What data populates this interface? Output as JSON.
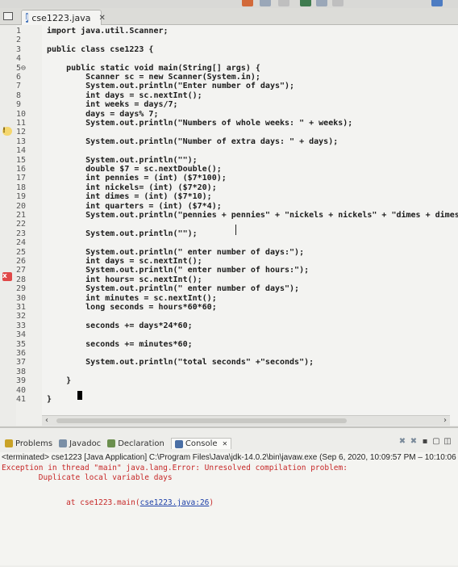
{
  "editor_tab": {
    "title": "cse1223.java",
    "close": "✕",
    "icon_text": "J"
  },
  "gutter": {
    "line_numbers": [
      "1",
      "2",
      "3",
      "4",
      "5⊖",
      "6",
      "7",
      "8",
      "9",
      "10",
      "11",
      "12",
      "13",
      "14",
      "15",
      "16",
      "17",
      "18",
      "19",
      "20",
      "21",
      "22",
      "23",
      "24",
      "25",
      "26",
      "27",
      "28",
      "29",
      "30",
      "31",
      "32",
      "33",
      "34",
      "35",
      "36",
      "37",
      "38",
      "39",
      "40",
      "41"
    ]
  },
  "code": {
    "lines": [
      "import java.util.Scanner;",
      "",
      "public class cse1223 {",
      "",
      "    public static void main(String[] args) {",
      "        Scanner sc = new Scanner(System.in);",
      "        System.out.println(\"Enter number of days\");",
      "        int days = sc.nextInt();",
      "        int weeks = days/7;",
      "        days = days% 7;",
      "        System.out.println(\"Numbers of whole weeks: \" + weeks);",
      "",
      "        System.out.println(\"Number of extra days: \" + days);",
      "",
      "        System.out.println(\"\");",
      "        double $7 = sc.nextDouble();",
      "        int pennies = (int) ($7*100);",
      "        int nickels= (int) ($7*20);",
      "        int dimes = (int) ($7*10);",
      "        int quarters = (int) ($7*4);",
      "        System.out.println(\"pennies + pennies\" + \"nickels + nickels\" + \"dimes + dimes\" +",
      "",
      "        System.out.println(\"\");",
      "",
      "        System.out.println(\" enter number of days:\");",
      "        int days = sc.nextInt();",
      "        System.out.println(\" enter number of hours:\");",
      "        int hours= sc.nextInt();",
      "        System.out.println(\" enter number of days\");",
      "        int minutes = sc.nextInt();",
      "        long seconds = hours*60*60;",
      "",
      "        seconds += days*24*60;",
      "",
      "        seconds += minutes*60;",
      "",
      "        System.out.println(\"total seconds\" +\"seconds\");",
      "",
      "    }",
      "",
      "}"
    ]
  },
  "panel": {
    "tabs": [
      {
        "label": "Problems",
        "color": "#c9a227"
      },
      {
        "label": "Javadoc",
        "color": "#7a8fa6"
      },
      {
        "label": "Declaration",
        "color": "#6b8f4e"
      },
      {
        "label": "Console",
        "color": "#4a6fa5"
      }
    ],
    "console_close": "✕",
    "terminated": "<terminated> cse1223 [Java Application] C:\\Program Files\\Java\\jdk-14.0.2\\bin\\javaw.exe (Sep 6, 2020, 10:09:57 PM – 10:10:06 PM)",
    "error_line1": "Exception in thread \"main\" java.lang.Error: Unresolved compilation problem:",
    "error_line2": "        Duplicate local variable days",
    "error_line3_prefix": "        at cse1223.main(",
    "error_link": "cse1223.java:26",
    "error_line3_suffix": ")"
  }
}
